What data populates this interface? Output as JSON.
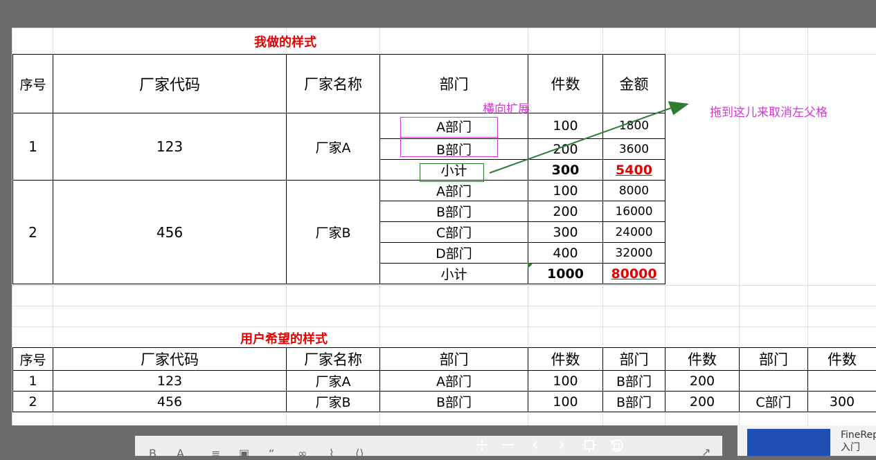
{
  "top_section": {
    "title": "我做的样式",
    "headers": [
      "序号",
      "厂家代码",
      "厂家名称",
      "部门",
      "件数",
      "金额"
    ],
    "groups": [
      {
        "seq": "1",
        "code": "123",
        "name": "厂家A",
        "rows": [
          {
            "dept": "A部门",
            "qty": "100",
            "amount": "1800"
          },
          {
            "dept": "B部门",
            "qty": "200",
            "amount": "3600"
          },
          {
            "dept": "小计",
            "qty": "300",
            "amount": "5400"
          }
        ]
      },
      {
        "seq": "2",
        "code": "456",
        "name": "厂家B",
        "rows": [
          {
            "dept": "A部门",
            "qty": "100",
            "amount": "8000"
          },
          {
            "dept": "B部门",
            "qty": "200",
            "amount": "16000"
          },
          {
            "dept": "C部门",
            "qty": "300",
            "amount": "24000"
          },
          {
            "dept": "D部门",
            "qty": "400",
            "amount": "32000"
          },
          {
            "dept": "小计",
            "qty": "1000",
            "amount": "80000"
          }
        ]
      }
    ]
  },
  "annotations": {
    "horizontal_expand": "横向扩展",
    "drag_hint": "拖到这儿来取消左父格"
  },
  "bottom_section": {
    "title": "用户希望的样式",
    "headers": [
      "序号",
      "厂家代码",
      "厂家名称",
      "部门",
      "件数",
      "部门",
      "件数",
      "部门",
      "件数"
    ],
    "rows": [
      [
        "1",
        "123",
        "厂家A",
        "A部门",
        "100",
        "B部门",
        "200",
        "",
        ""
      ],
      [
        "2",
        "456",
        "厂家B",
        "B部门",
        "100",
        "B部门",
        "200",
        "C部门",
        "300"
      ]
    ]
  },
  "viewer_toolbar": {
    "zoom_in": "+",
    "zoom_out": "−",
    "prev": "‹",
    "next": "›"
  },
  "thumbnail": {
    "label_line1": "FineRep",
    "label_line2": "入门"
  },
  "colors": {
    "title_red": "#e60000",
    "annotation_magenta": "#d636d6",
    "arrow_green": "#2e7d32"
  }
}
